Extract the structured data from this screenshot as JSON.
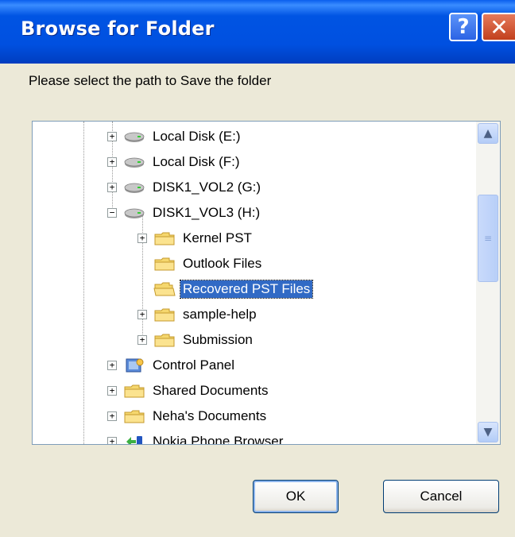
{
  "window": {
    "title": "Browse for Folder",
    "help_label": "?",
    "close_label": "✕"
  },
  "dialog": {
    "prompt": "Please select the path to Save the folder"
  },
  "tree": {
    "items": [
      {
        "label": "Local Disk (E:)",
        "icon": "drive-icon",
        "expander": "+",
        "level": 1
      },
      {
        "label": "Local Disk (F:)",
        "icon": "drive-icon",
        "expander": "+",
        "level": 1
      },
      {
        "label": "DISK1_VOL2 (G:)",
        "icon": "drive-icon",
        "expander": "+",
        "level": 1
      },
      {
        "label": "DISK1_VOL3 (H:)",
        "icon": "drive-icon",
        "expander": "−",
        "level": 1
      },
      {
        "label": "Kernel PST",
        "icon": "folder-icon",
        "expander": "+",
        "level": 2
      },
      {
        "label": "Outlook Files",
        "icon": "folder-icon",
        "expander": "",
        "level": 2
      },
      {
        "label": "Recovered PST Files",
        "icon": "folder-open-icon",
        "expander": "",
        "level": 2,
        "selected": true
      },
      {
        "label": "sample-help",
        "icon": "folder-icon",
        "expander": "+",
        "level": 2
      },
      {
        "label": "Submission",
        "icon": "folder-icon",
        "expander": "+",
        "level": 2
      },
      {
        "label": "Control Panel",
        "icon": "control-panel-icon",
        "expander": "+",
        "level": 1
      },
      {
        "label": "Shared Documents",
        "icon": "folder-icon",
        "expander": "+",
        "level": 1
      },
      {
        "label": "Neha's Documents",
        "icon": "folder-icon",
        "expander": "+",
        "level": 1
      },
      {
        "label": "Nokia Phone Browser",
        "icon": "phone-browser-icon",
        "expander": "+",
        "level": 1
      }
    ]
  },
  "buttons": {
    "ok": "OK",
    "cancel": "Cancel"
  },
  "colors": {
    "titlebar": "#0054E3",
    "selection": "#316AC5",
    "dialog_bg": "#ECE9D8"
  }
}
